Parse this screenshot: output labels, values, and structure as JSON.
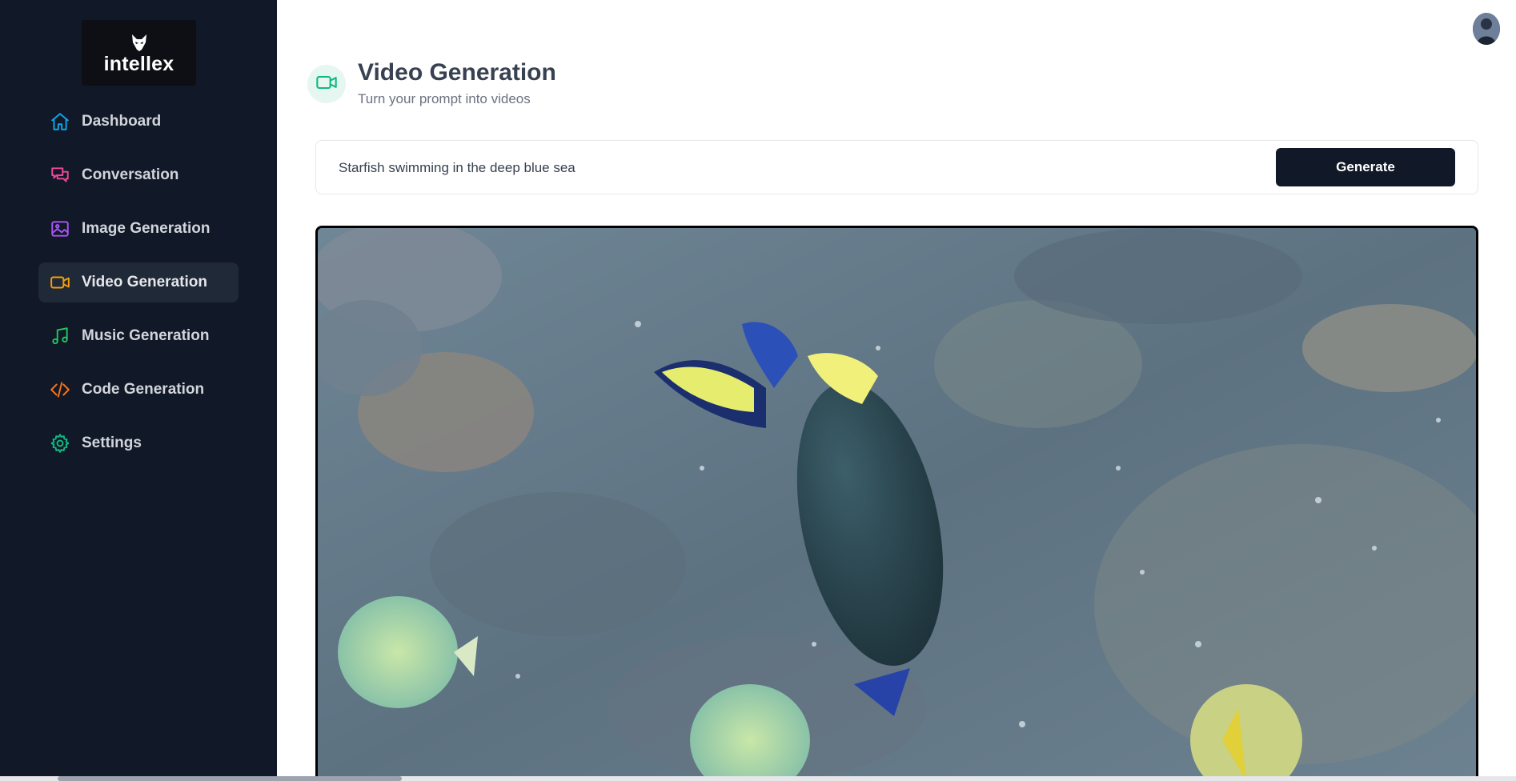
{
  "brand": {
    "name": "intellex",
    "logo_icon": "fox-head-icon"
  },
  "sidebar": {
    "items": [
      {
        "label": "Dashboard",
        "icon": "home-icon",
        "color": "#0ea5e9"
      },
      {
        "label": "Conversation",
        "icon": "message-icon",
        "color": "#ec4899"
      },
      {
        "label": "Image Generation",
        "icon": "image-icon",
        "color": "#a855f7"
      },
      {
        "label": "Video Generation",
        "icon": "video-icon",
        "color": "#f59e0b",
        "active": true
      },
      {
        "label": "Music Generation",
        "icon": "music-icon",
        "color": "#22c55e"
      },
      {
        "label": "Code Generation",
        "icon": "code-icon",
        "color": "#f97316"
      },
      {
        "label": "Settings",
        "icon": "gear-icon",
        "color": "#10b981"
      }
    ]
  },
  "header": {
    "title": "Video Generation",
    "subtitle": "Turn your prompt into videos",
    "icon": "video-icon",
    "icon_color": "#10b981"
  },
  "prompt": {
    "value": "Starfish swimming in the deep blue sea",
    "button_label": "Generate"
  },
  "video": {
    "content": "underwater-fish-video"
  },
  "user": {
    "avatar": "user-avatar"
  }
}
